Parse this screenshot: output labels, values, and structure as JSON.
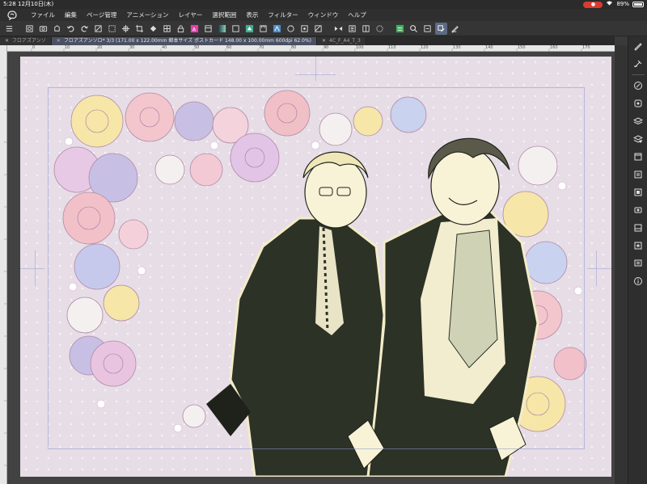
{
  "status": {
    "time": "5:28",
    "date": "12月10日(木)",
    "battery_text": "89%",
    "battery_level": 0.89,
    "colors": {
      "record": "#d93b30"
    }
  },
  "app_icon": "clip-studio-icon",
  "menu": [
    "ファイル",
    "編集",
    "ページ管理",
    "アニメーション",
    "レイヤー",
    "選択範囲",
    "表示",
    "フィルター",
    "ウィンドウ",
    "ヘルプ"
  ],
  "tabs": [
    {
      "label": "フロアズアンソ",
      "active": false
    },
    {
      "label": "フロアズアンソロ* 3/3 (171.00 x 122.00mm 郵本サイズ ポストカード 148.00 x 100.00mm 600dpi 62.0%)",
      "active": true
    },
    {
      "label": "4C_F_A4_T_3",
      "active": false
    }
  ],
  "ruler_ticks": [
    "0",
    "10",
    "20",
    "30",
    "40",
    "50",
    "60",
    "70",
    "80",
    "90",
    "100",
    "110",
    "120",
    "130",
    "140",
    "150",
    "160",
    "170"
  ],
  "toolbar_icons": [
    "menu-icon",
    "new-icon",
    "open-icon",
    "save-icon",
    "undo-icon",
    "redo-icon",
    "clear-icon",
    "select-all-icon",
    "transform-icon",
    "crop-icon",
    "fill-icon",
    "layer-property-icon",
    "lock-icon",
    "tone-icon",
    "color-icon",
    "gradient-icon",
    "blend-icon",
    "reference-icon",
    "ruler-icon",
    "flip-icon",
    "rotate-icon",
    "snap-icon",
    "grid-icon",
    "symmetry-icon",
    "color-layer-icon",
    "search-icon",
    "settings-icon",
    "edit-icon"
  ],
  "right_panel_icons": [
    "pen-icon",
    "brush-icon",
    "navigator-icon",
    "sub-tool-icon",
    "layer-icon",
    "layer-property-icon",
    "color-wheel-icon",
    "history-icon",
    "material-icon",
    "timeline-icon",
    "auto-action-icon",
    "favorite-icon",
    "comment-icon",
    "info-icon"
  ],
  "canvas": {
    "background": "#e7dde6",
    "dot_color": "#f6f1f6",
    "guide_color": "#8c96d2"
  }
}
